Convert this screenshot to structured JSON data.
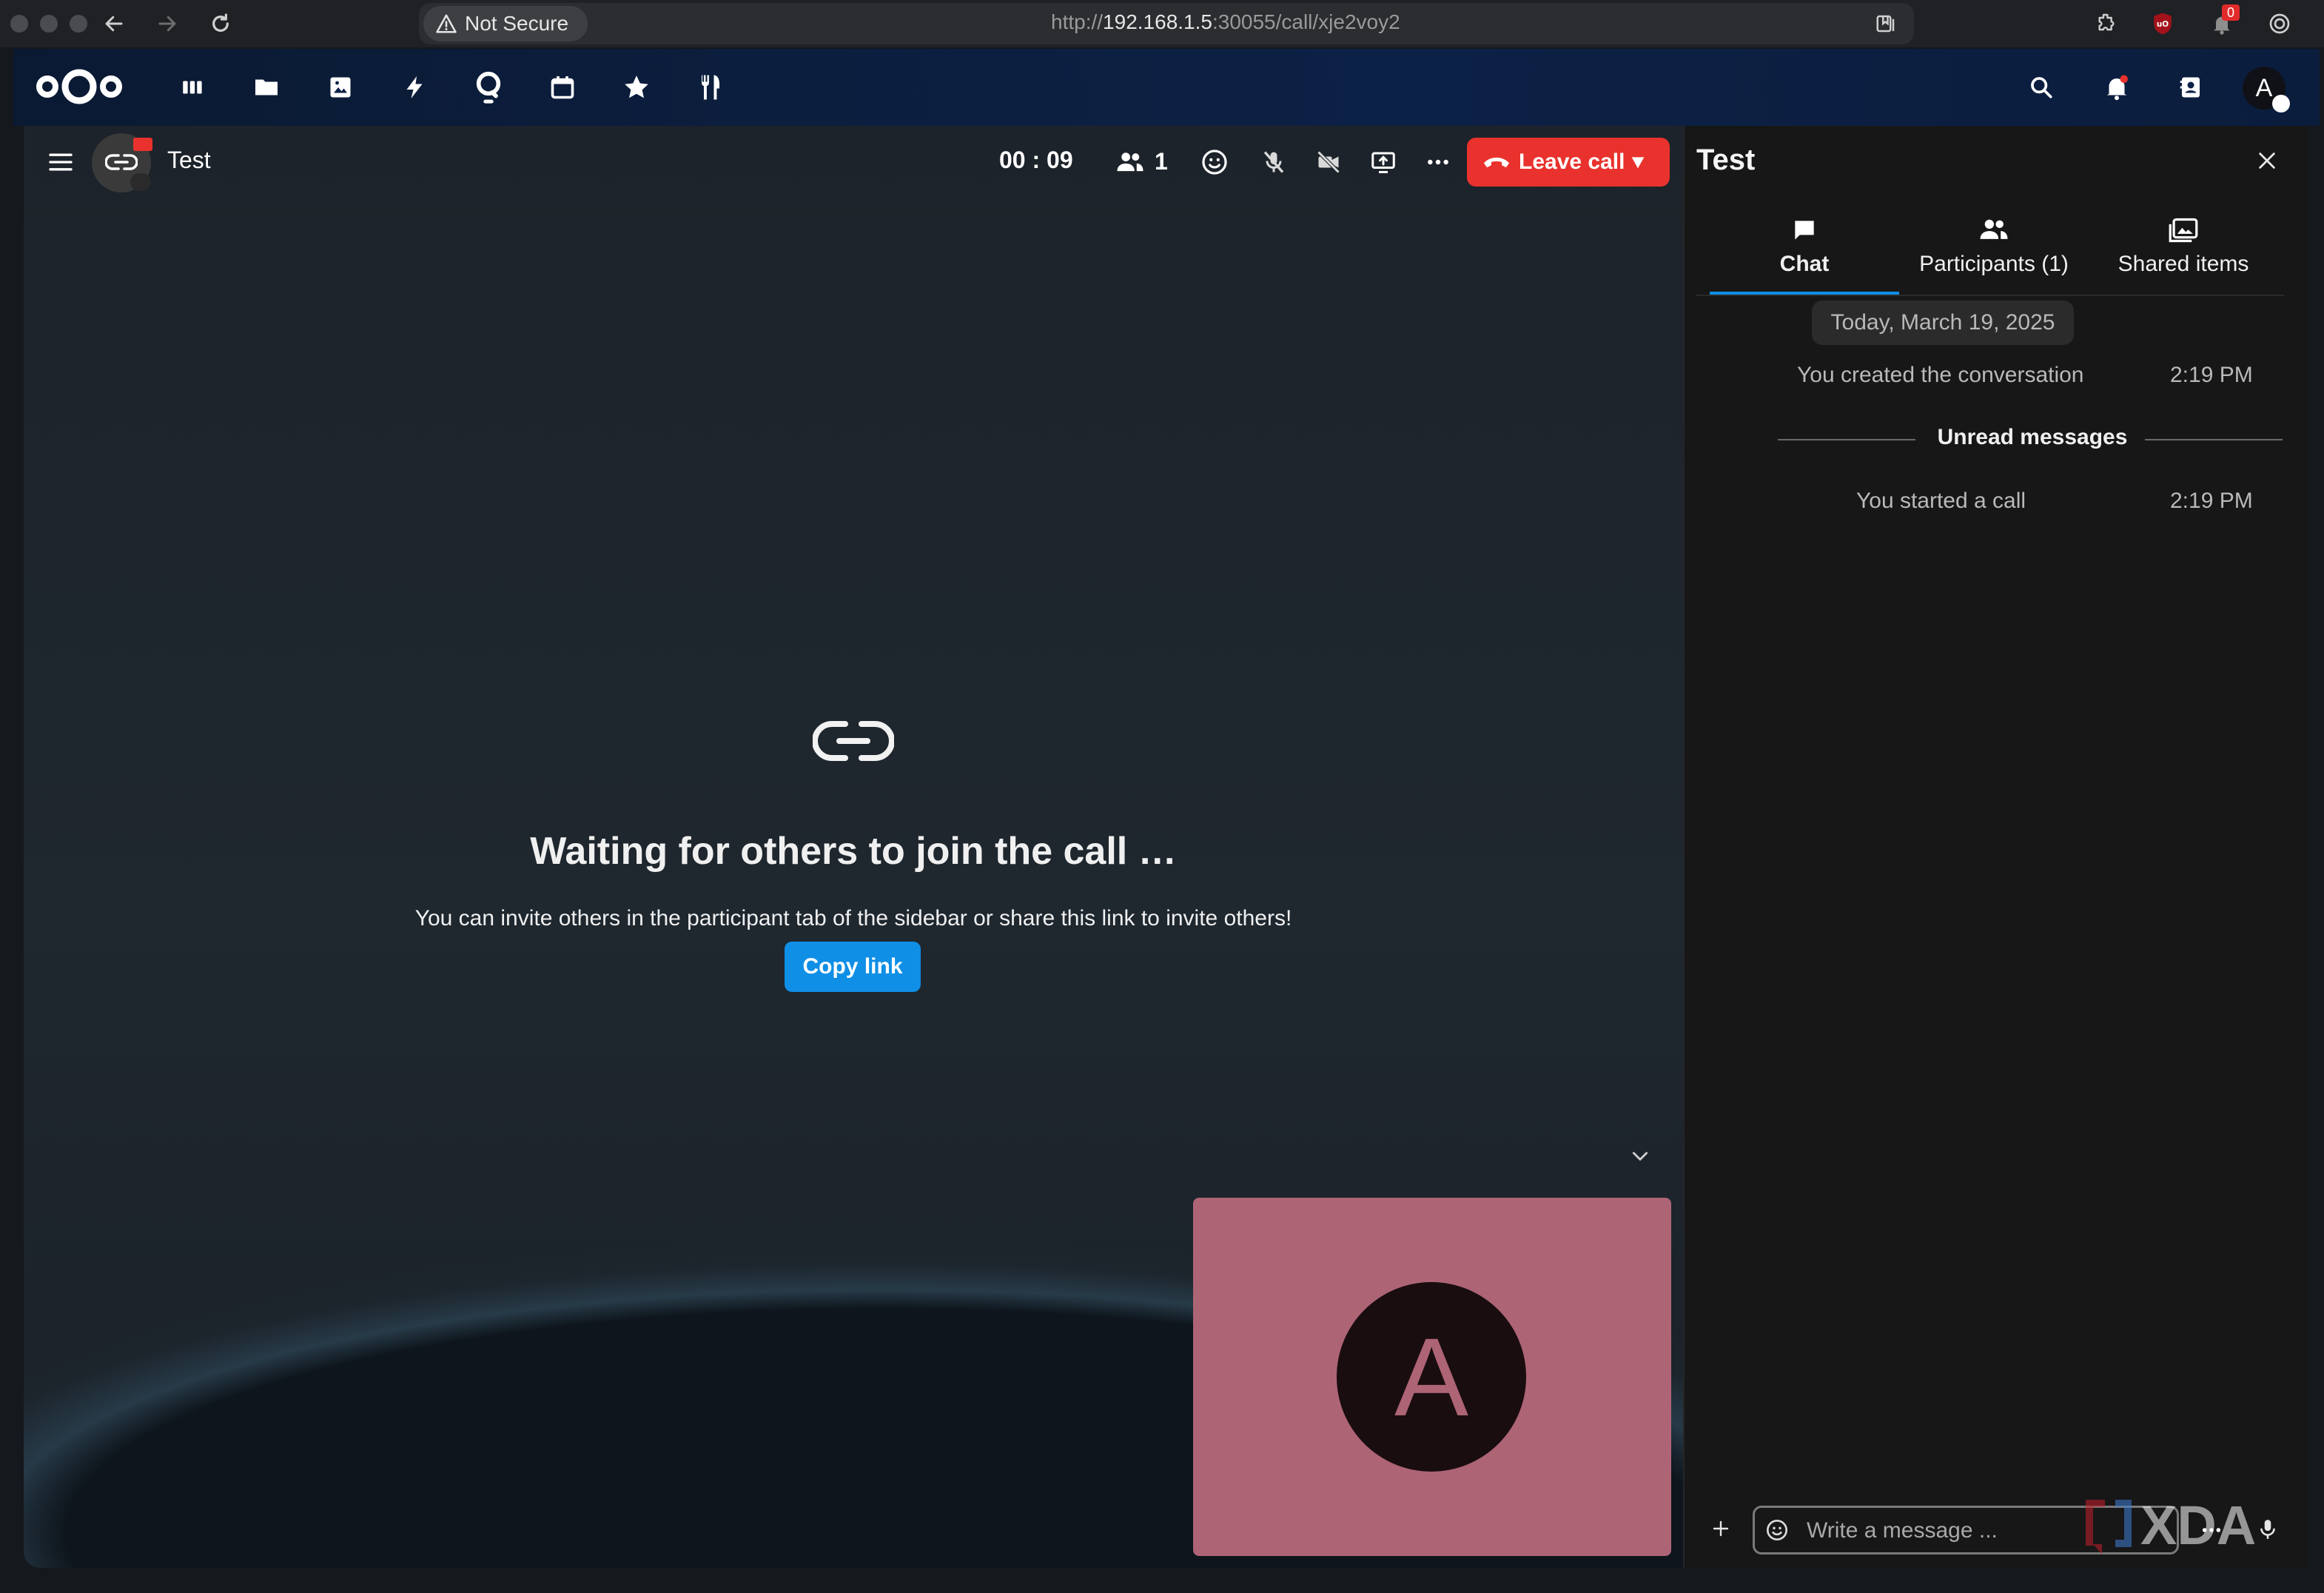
{
  "browser": {
    "security_label": "Not Secure",
    "url_scheme": "http://",
    "url_host": "192.168.1.5",
    "url_rest": ":30055/call/xje2voy2",
    "extension_badge_count": "0"
  },
  "header": {
    "apps": [
      "dashboard",
      "files",
      "photos",
      "activity",
      "talk",
      "calendar",
      "favorites",
      "cookbook"
    ],
    "avatar_initial": "A"
  },
  "call": {
    "conversation_name": "Test",
    "timer": "00 : 09",
    "participant_count": "1",
    "leave_label": "Leave call",
    "waiting_title": "Waiting for others to join the call …",
    "waiting_subtitle": "You can invite others in the participant tab of the sidebar or share this link to invite others!",
    "copy_link_label": "Copy link",
    "self_initial": "A"
  },
  "sidebar": {
    "title": "Test",
    "tabs": [
      {
        "label": "Chat",
        "active": true
      },
      {
        "label": "Participants (1)",
        "active": false
      },
      {
        "label": "Shared items",
        "active": false
      }
    ],
    "date_separator": "Today, March 19, 2025",
    "messages": [
      {
        "text": "You created the conversation",
        "time": "2:19 PM"
      },
      {
        "text": "You started a call",
        "time": "2:19 PM"
      }
    ],
    "unread_label": "Unread messages",
    "composer_placeholder": "Write a message ..."
  },
  "watermark": "XDA",
  "colors": {
    "accent_blue": "#0f8fe6",
    "leave_red": "#e9322d",
    "self_tile": "#ad6475",
    "header_navy": "#0c2146"
  }
}
